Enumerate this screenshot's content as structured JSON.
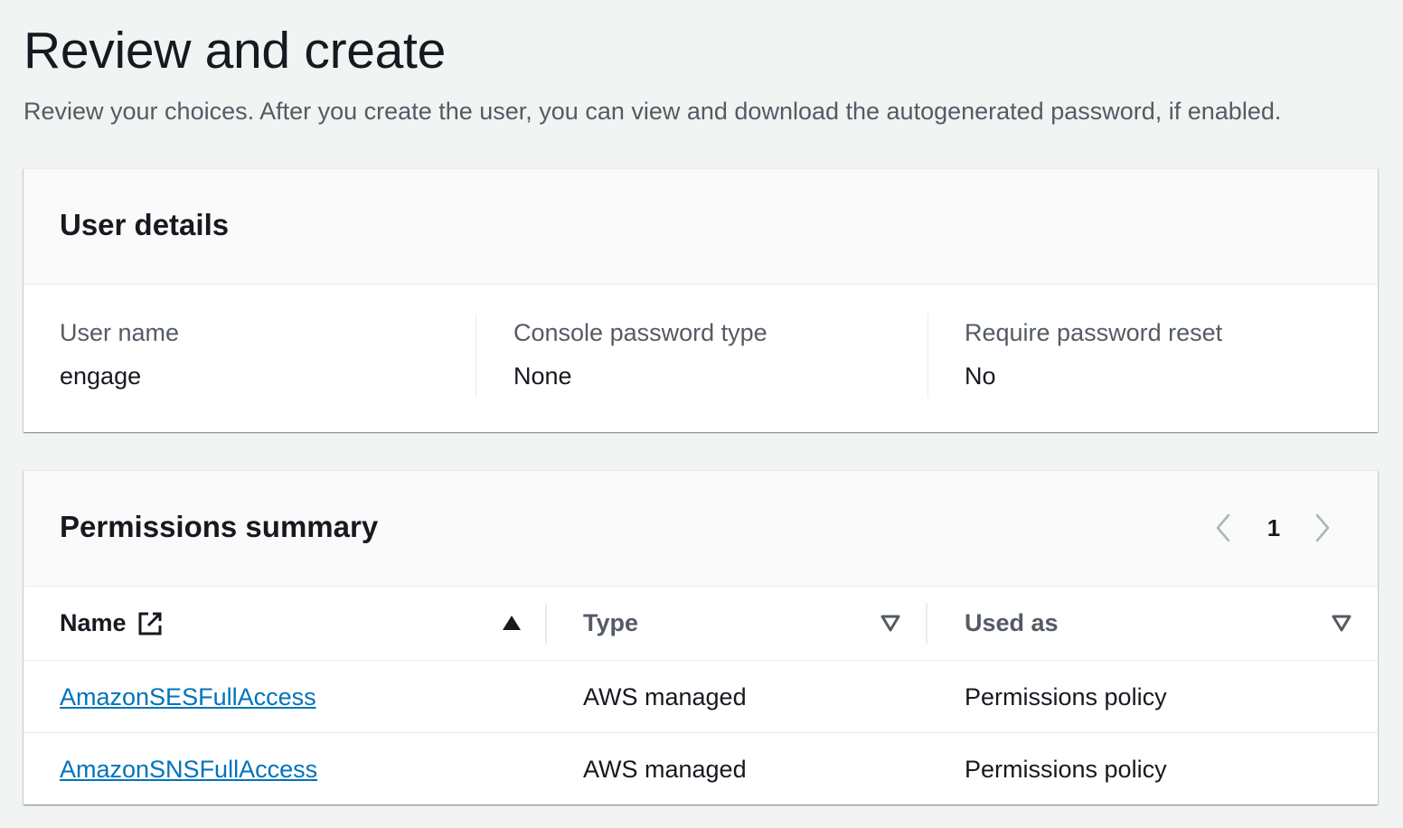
{
  "page": {
    "title": "Review and create",
    "description": "Review your choices. After you create the user, you can view and download the autogenerated password, if enabled."
  },
  "user_details": {
    "title": "User details",
    "fields": [
      {
        "label": "User name",
        "value": "engage"
      },
      {
        "label": "Console password type",
        "value": "None"
      },
      {
        "label": "Require password reset",
        "value": "No"
      }
    ]
  },
  "permissions_summary": {
    "title": "Permissions summary",
    "pagination": {
      "current_page": "1"
    },
    "columns": [
      {
        "label": "Name",
        "sort": "ascending",
        "icon": "external-link-icon"
      },
      {
        "label": "Type",
        "sort": "none"
      },
      {
        "label": "Used as",
        "sort": "none"
      }
    ],
    "rows": [
      {
        "name": "AmazonSESFullAccess",
        "type": "AWS managed",
        "used_as": "Permissions policy"
      },
      {
        "name": "AmazonSNSFullAccess",
        "type": "AWS managed",
        "used_as": "Permissions policy"
      }
    ]
  },
  "colors": {
    "link": "#0073bb",
    "text": "#16191f",
    "secondary_text": "#545b64",
    "page_background": "#f2f3f3"
  }
}
